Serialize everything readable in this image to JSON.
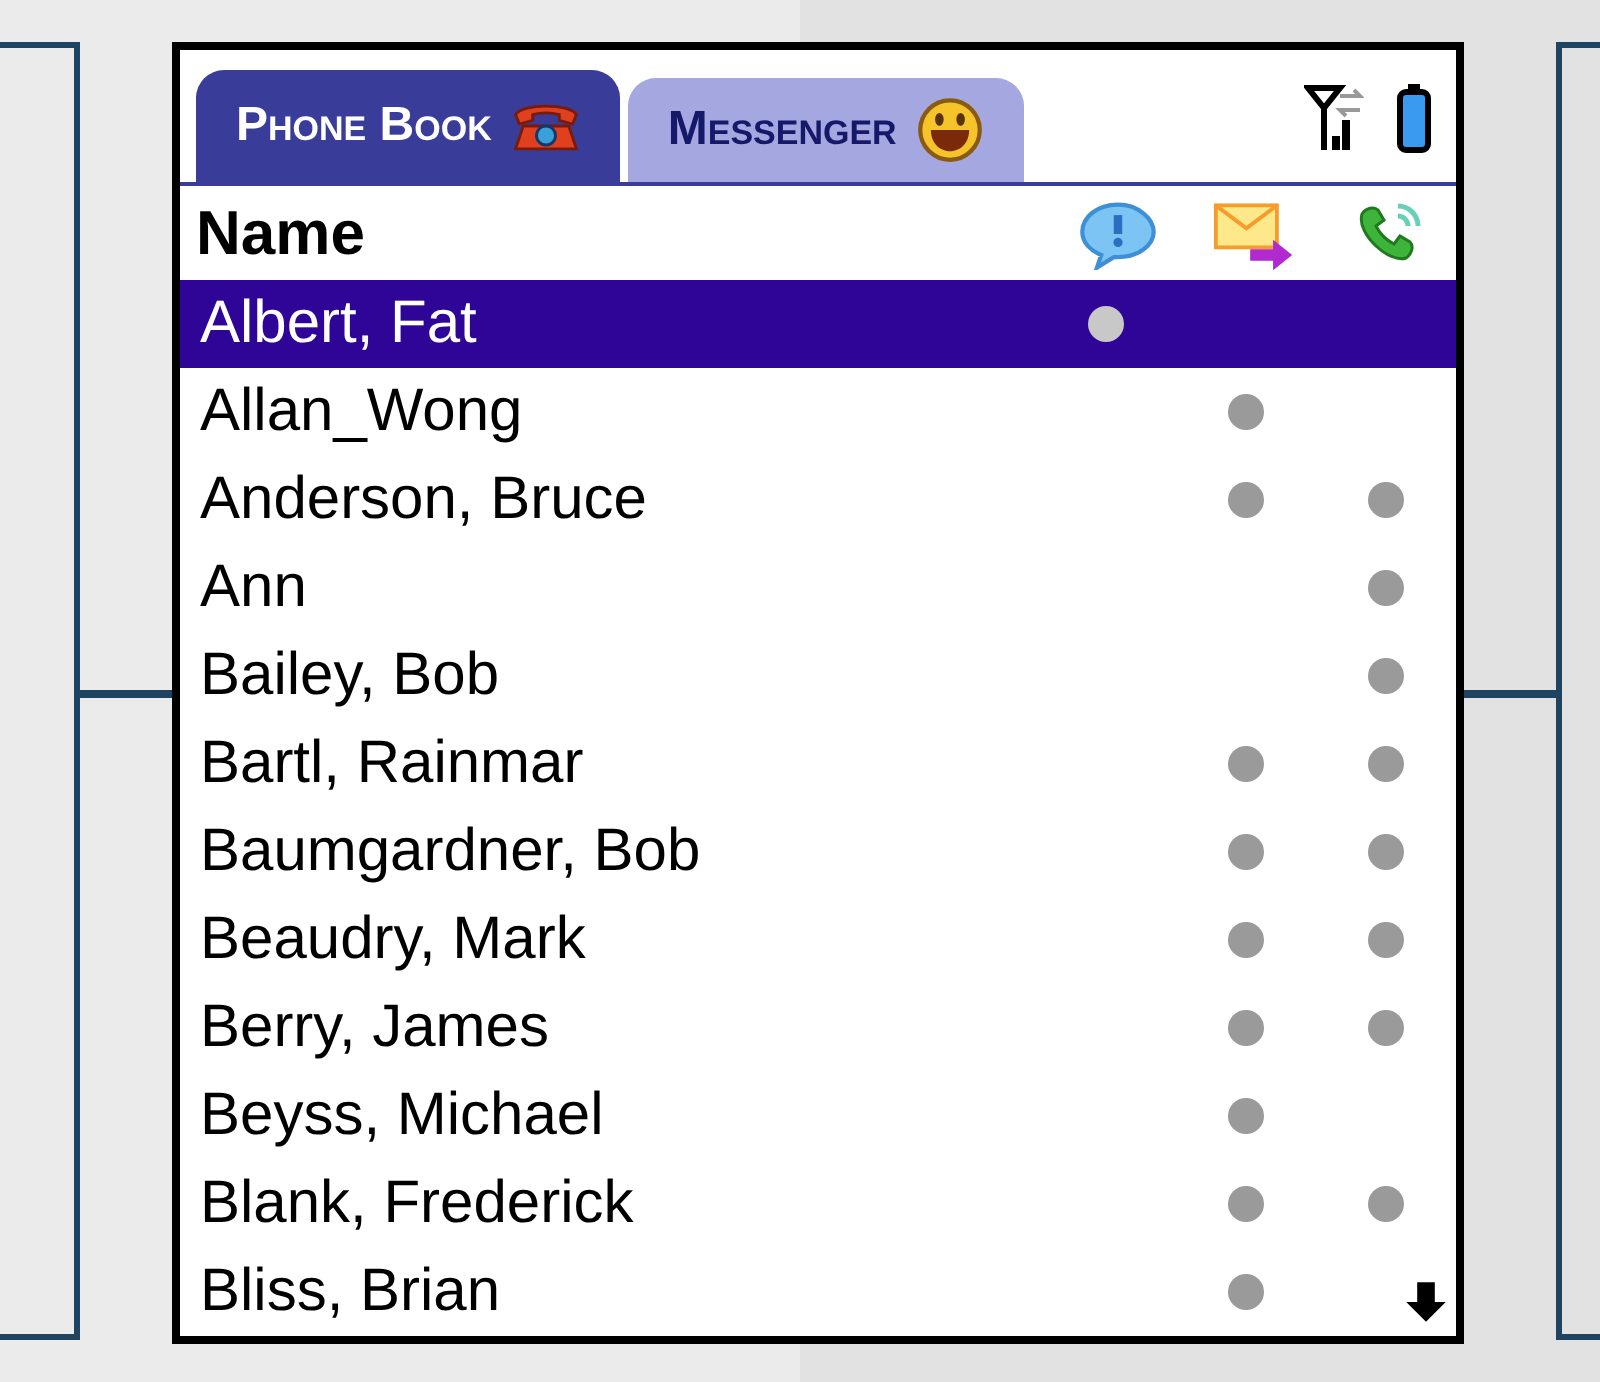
{
  "tabs": [
    {
      "label": "Phone Book",
      "selected": true
    },
    {
      "label": "Messenger",
      "selected": false
    }
  ],
  "list_header": {
    "label": "Name"
  },
  "contacts": [
    {
      "name": "Albert, Fat",
      "selected": true,
      "chat": true,
      "mail": false,
      "call": false
    },
    {
      "name": "Allan_Wong",
      "selected": false,
      "chat": false,
      "mail": true,
      "call": false
    },
    {
      "name": "Anderson, Bruce",
      "selected": false,
      "chat": false,
      "mail": true,
      "call": true
    },
    {
      "name": "Ann",
      "selected": false,
      "chat": false,
      "mail": false,
      "call": true
    },
    {
      "name": "Bailey, Bob",
      "selected": false,
      "chat": false,
      "mail": false,
      "call": true
    },
    {
      "name": "Bartl, Rainmar",
      "selected": false,
      "chat": false,
      "mail": true,
      "call": true
    },
    {
      "name": "Baumgardner, Bob",
      "selected": false,
      "chat": false,
      "mail": true,
      "call": true
    },
    {
      "name": "Beaudry, Mark",
      "selected": false,
      "chat": false,
      "mail": true,
      "call": true
    },
    {
      "name": "Berry, James",
      "selected": false,
      "chat": false,
      "mail": true,
      "call": true
    },
    {
      "name": "Beyss, Michael",
      "selected": false,
      "chat": false,
      "mail": true,
      "call": false
    },
    {
      "name": "Blank, Frederick",
      "selected": false,
      "chat": false,
      "mail": true,
      "call": true
    },
    {
      "name": "Bliss, Brian",
      "selected": false,
      "chat": false,
      "mail": true,
      "call": false
    }
  ]
}
